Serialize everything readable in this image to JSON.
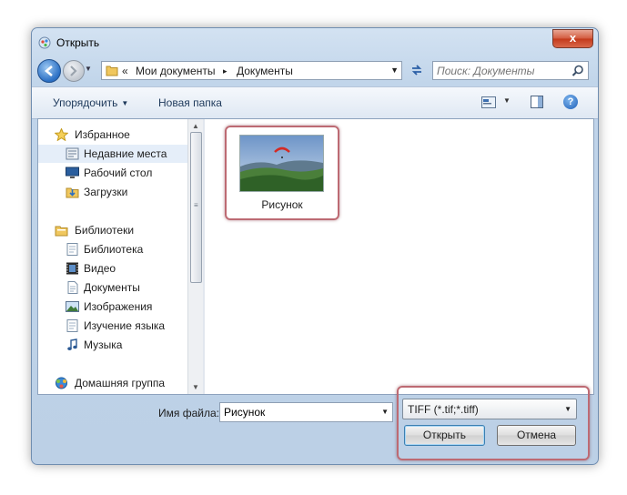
{
  "window": {
    "title": "Открыть",
    "close_glyph": "x"
  },
  "navigation": {
    "address_prefix": "«",
    "crumbs": [
      "Мои документы",
      "Документы"
    ],
    "separator": "▸",
    "search_placeholder": "Поиск: Документы"
  },
  "toolbar": {
    "organize_label": "Упорядочить",
    "new_folder_label": "Новая папка",
    "help_glyph": "?"
  },
  "sidebar": {
    "items": [
      {
        "label": "Избранное",
        "icon": "star-icon"
      },
      {
        "label": "Недавние места",
        "icon": "recent-places-icon",
        "selected": true
      },
      {
        "label": "Рабочий стол",
        "icon": "desktop-icon"
      },
      {
        "label": "Загрузки",
        "icon": "downloads-icon"
      },
      {
        "label": "Библиотеки",
        "icon": "libraries-icon"
      },
      {
        "label": "Библиотека",
        "icon": "library-icon"
      },
      {
        "label": "Видео",
        "icon": "video-icon"
      },
      {
        "label": "Документы",
        "icon": "documents-icon"
      },
      {
        "label": "Изображения",
        "icon": "pictures-icon"
      },
      {
        "label": "Изучение языка",
        "icon": "language-icon"
      },
      {
        "label": "Музыка",
        "icon": "music-icon"
      },
      {
        "label": "Домашняя группа",
        "icon": "homegroup-icon"
      }
    ]
  },
  "files": [
    {
      "name": "Рисунок",
      "thumbnail": "paraglider-landscape-image"
    }
  ],
  "footer": {
    "filename_label": "Имя файла:",
    "filename_value": "Рисунок",
    "filetype_value": "TIFF (*.tif;*.tiff)",
    "open_label": "Открыть",
    "cancel_label": "Отмена"
  },
  "colors": {
    "highlight_border": "#bd6a73",
    "selection_bg": "#e5eef9",
    "toolbar_text": "#1e395b"
  }
}
